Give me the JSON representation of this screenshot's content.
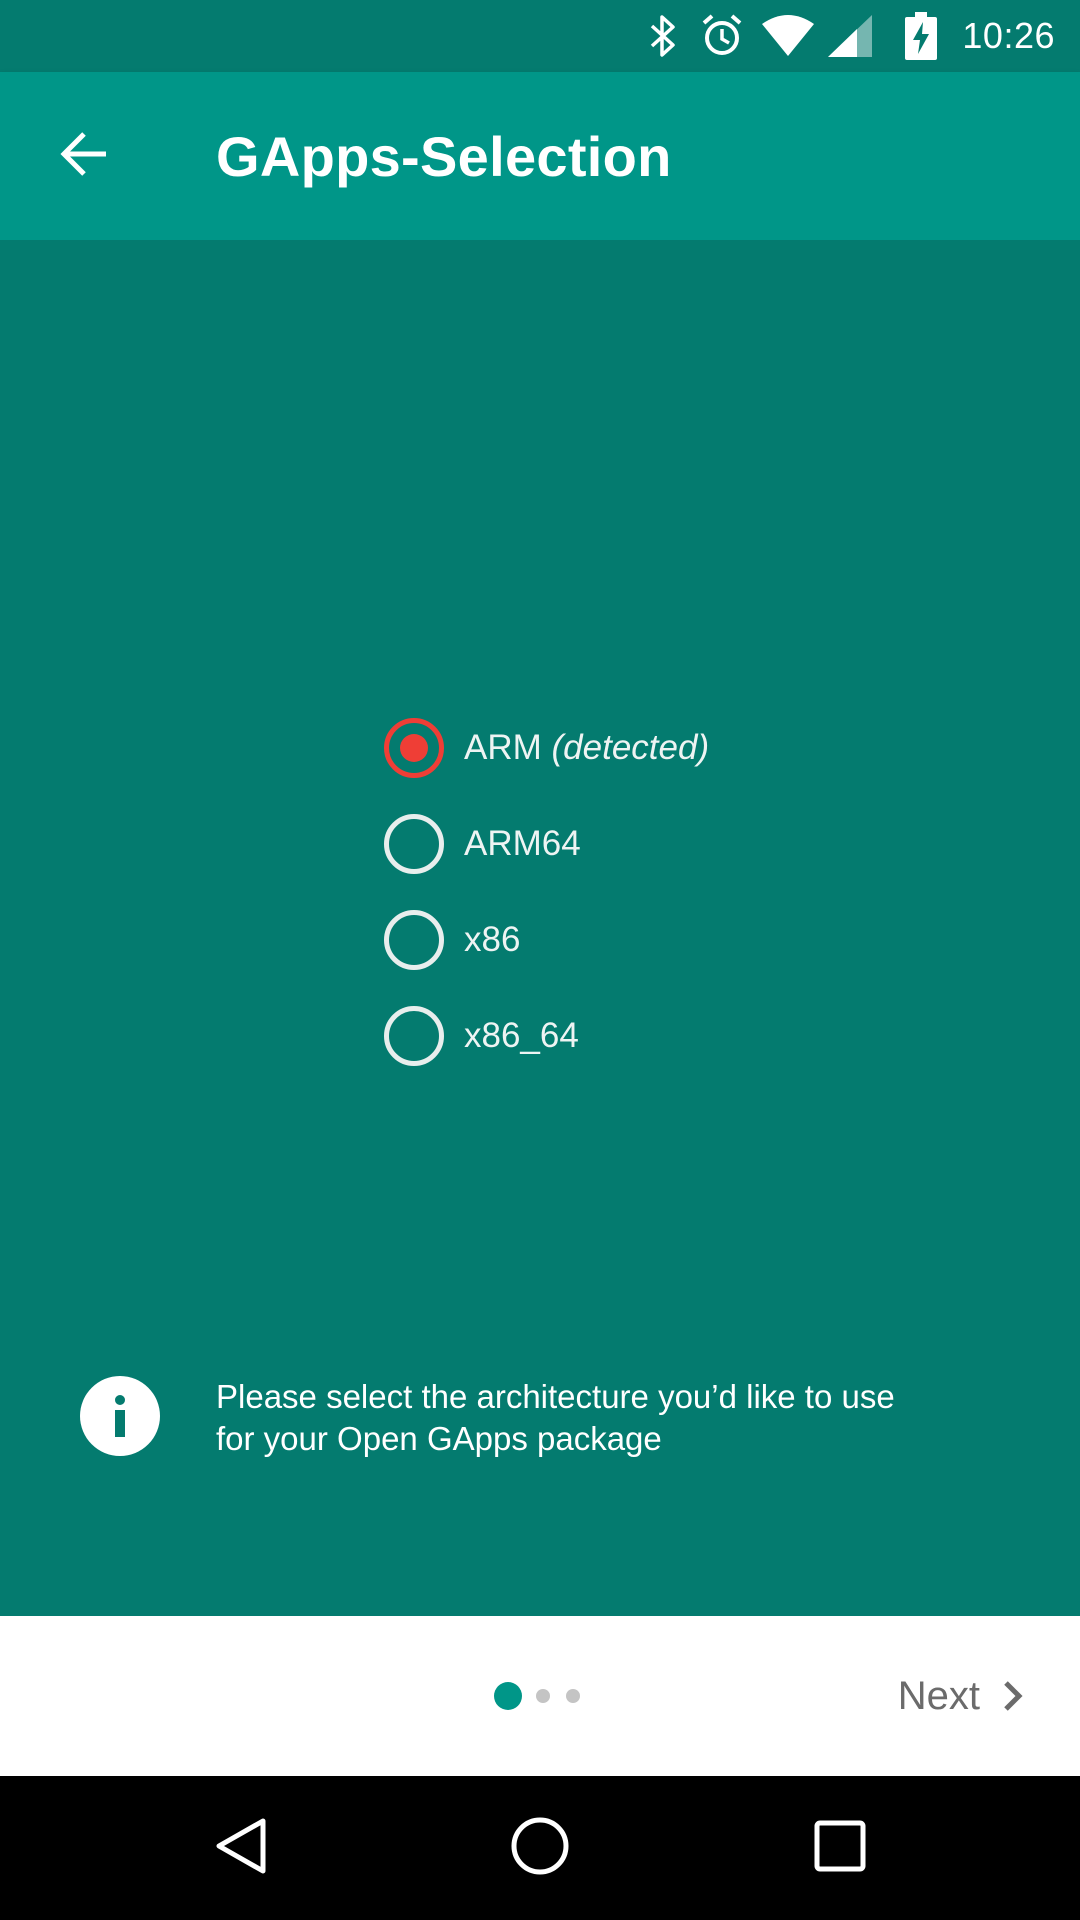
{
  "status_bar": {
    "time": "10:26",
    "icons": [
      "bluetooth-icon",
      "alarm-icon",
      "wifi-icon",
      "signal-icon",
      "battery-charging-icon"
    ]
  },
  "app_bar": {
    "title": "GApps-Selection",
    "back_icon": "arrow-back-icon"
  },
  "architecture": {
    "options": [
      {
        "label": "ARM",
        "note": "(detected)",
        "selected": true
      },
      {
        "label": "ARM64",
        "note": "",
        "selected": false
      },
      {
        "label": "x86",
        "note": "",
        "selected": false
      },
      {
        "label": "x86_64",
        "note": "",
        "selected": false
      }
    ]
  },
  "info": {
    "icon": "info-icon",
    "line1": "Please select the architecture you’d like to use",
    "line2": "for your Open GApps package"
  },
  "footer": {
    "pager": {
      "total": 3,
      "current": 1
    },
    "next_label": "Next"
  },
  "colors": {
    "primary": "#009688",
    "primary_dark": "#047b6f",
    "accent": "#ef3e36"
  }
}
